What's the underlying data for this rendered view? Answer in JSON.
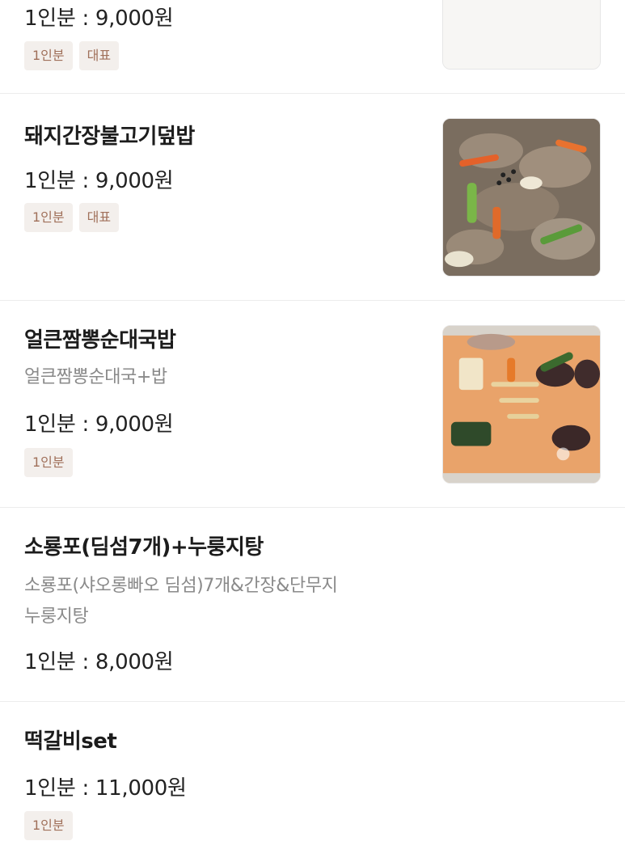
{
  "items": [
    {
      "price": "1인분 : 9,000원",
      "tags": [
        "1인분",
        "대표"
      ],
      "image": "plate-of-spicy-dish-with-rice"
    },
    {
      "title": "돼지간장불고기덮밥",
      "price": "1인분 : 9,000원",
      "tags": [
        "1인분",
        "대표"
      ],
      "image": "pork-soy-bulgogi-photo"
    },
    {
      "title": "얼큰짬뽕순대국밥",
      "description": "얼큰짬뽕순대국+밥",
      "price": "1인분 : 9,000원",
      "tags": [
        "1인분"
      ],
      "image": "spicy-jjamppong-sundae-soup-photo"
    },
    {
      "title": "소룡포(딤섬7개)+누룽지탕",
      "description_lines": [
        "소룡포(샤오롱빠오 딤섬)7개&간장&단무지",
        "누룽지탕"
      ],
      "price": "1인분 : 8,000원"
    },
    {
      "title": "떡갈비set",
      "price": "1인분 : 11,000원",
      "tags": [
        "1인분"
      ]
    }
  ]
}
